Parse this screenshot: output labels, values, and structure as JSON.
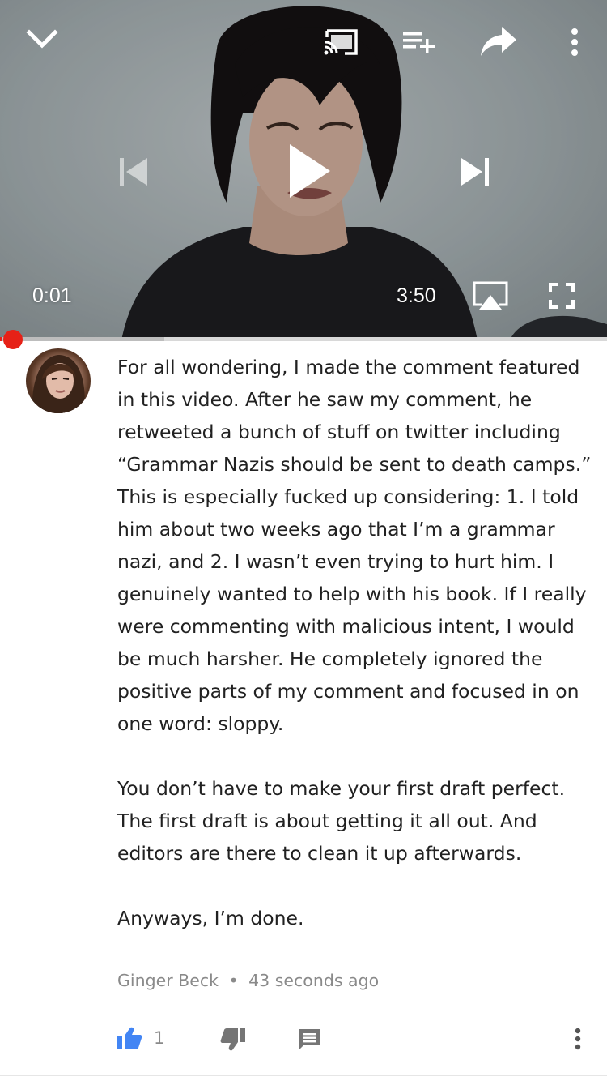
{
  "player": {
    "time_current": "0:01",
    "time_total": "3:50",
    "progress_fraction": 0.004,
    "buffered_fraction": 0.27,
    "icons": {
      "collapse": "chevron-down-icon",
      "cast": "cast-icon",
      "add_to_queue": "add-to-queue-icon",
      "share": "share-icon",
      "more": "more-vertical-icon",
      "previous": "skip-previous-icon",
      "play": "play-icon",
      "next": "skip-next-icon",
      "airplay": "airplay-icon",
      "fullscreen": "fullscreen-icon"
    },
    "accent_color": "#e62117"
  },
  "comment": {
    "paragraphs": [
      "For all wondering, I made the comment featured in this video. After he saw my comment, he retweeted a bunch of stuff on twitter including “Grammar Nazis should be sent to death camps.” This is especially fucked up considering: 1. I told him about two weeks ago that I’m a grammar nazi, and 2. I wasn’t even trying to hurt him. I genuinely wanted to help with his book. If I really were commenting with malicious intent, I would be much harsher. He completely ignored the positive parts of my comment and focused in on one word: sloppy.",
      "You don’t have to make your first draft perfect. The first draft is about getting it all out. And editors are there to clean it up afterwards.",
      "Anyways, I’m done."
    ],
    "author": "Ginger Beck",
    "separator": "•",
    "timestamp": "43 seconds ago",
    "like_count": "1",
    "icons": {
      "like": "thumbs-up-icon",
      "dislike": "thumbs-down-icon",
      "reply": "reply-icon",
      "more": "more-vertical-icon"
    },
    "like_color": "#4285f4",
    "icon_color": "#757575"
  }
}
